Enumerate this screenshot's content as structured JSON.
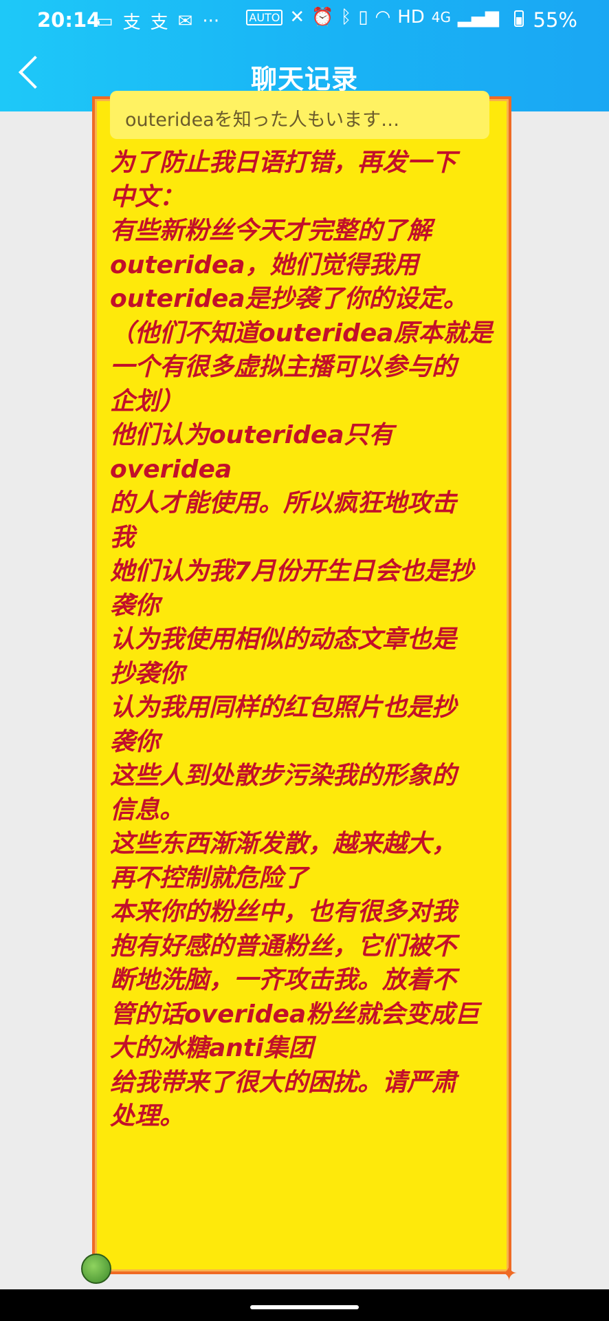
{
  "status_bar": {
    "time": "20:14",
    "left_icons": [
      "video-icon",
      "alipay-icon",
      "alipay-icon",
      "mail-icon",
      "more-dots"
    ],
    "right_icons": [
      "auto-hz-icon",
      "x-icon",
      "alarm-icon",
      "bluetooth-icon",
      "vibrate-icon",
      "wifi-icon",
      "hd-icon",
      "4g-icon",
      "signal-icon"
    ],
    "hd": "HD",
    "network": "4G",
    "battery_percent": "55%"
  },
  "header": {
    "title": "聊天记录",
    "back_icon": "chevron-left-icon",
    "background_color": "#1ab5f5"
  },
  "message": {
    "quoted_preview": "outerideaを知った人もいます…",
    "bubble_color": "#fee90b",
    "text_color": "#c2102a",
    "paragraphs": [
      "为了防止我日语打错，再发一下\n中文：",
      "",
      "",
      "有些新粉丝今天才完整的了解\nouteridea，她们觉得我用\nouteridea是抄袭了你的设定。\n（他们不知道outeridea原本就是\n一个有很多虚拟主播可以参与的\n企划）\n他们认为outeridea只有overidea\n的人才能使用。所以疯狂地攻击\n我",
      "",
      "她们认为我7月份开生日会也是抄\n袭你\n认为我使用相似的动态文章也是\n抄袭你\n认为我用同样的红包照片也是抄\n袭你\n这些人到处散步污染我的形象的\n信息。",
      "",
      "这些东西渐渐发散，越来越大，\n再不控制就危险了\n本来你的粉丝中，也有很多对我\n抱有好感的普通粉丝，它们被不\n断地洗脑，一齐攻击我。放着不\n管的话overidea粉丝就会变成巨\n大的冰糖anti集团",
      "",
      "给我带来了很大的困扰。请严肃\n处理。"
    ]
  }
}
